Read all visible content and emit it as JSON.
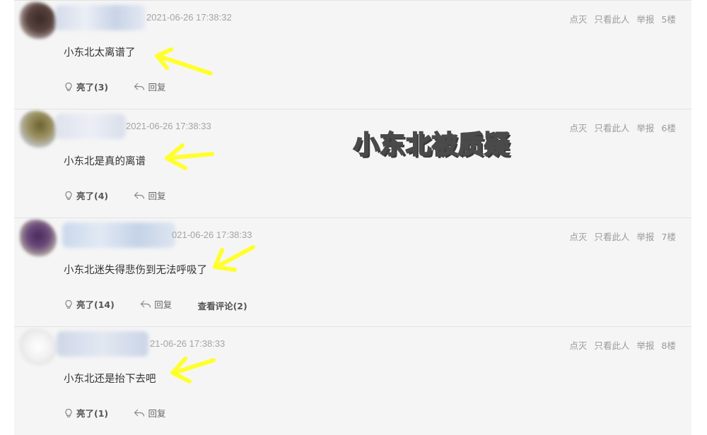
{
  "colors": {
    "accent": "#f3e82a",
    "arrow": "#ffff2e",
    "text": "#333333",
    "muted": "#a4a4a4"
  },
  "caption": "小东北被质疑",
  "posts": [
    {
      "time": "2021-06-26 17:38:32",
      "content": "小东北太离谱了",
      "ops": {
        "down": "点灭",
        "only": "只看此人",
        "report": "举报",
        "floor": "5楼"
      },
      "like": "亮了(3)",
      "reply": "回复",
      "view_comments": ""
    },
    {
      "time": "2021-06-26 17:38:33",
      "content": "小东北是真的离谱",
      "ops": {
        "down": "点灭",
        "only": "只看此人",
        "report": "举报",
        "floor": "6楼"
      },
      "like": "亮了(4)",
      "reply": "回复",
      "view_comments": ""
    },
    {
      "time": "021-06-26 17:38:33",
      "content": "小东北迷失得悲伤到无法呼吸了",
      "ops": {
        "down": "点灭",
        "only": "只看此人",
        "report": "举报",
        "floor": "7楼"
      },
      "like": "亮了(14)",
      "reply": "回复",
      "view_comments": "查看评论(2)"
    },
    {
      "time": "21-06-26 17:38:33",
      "content": "小东北还是抬下去吧",
      "ops": {
        "down": "点灭",
        "only": "只看此人",
        "report": "举报",
        "floor": "8楼"
      },
      "like": "亮了(1)",
      "reply": "回复",
      "view_comments": ""
    }
  ]
}
